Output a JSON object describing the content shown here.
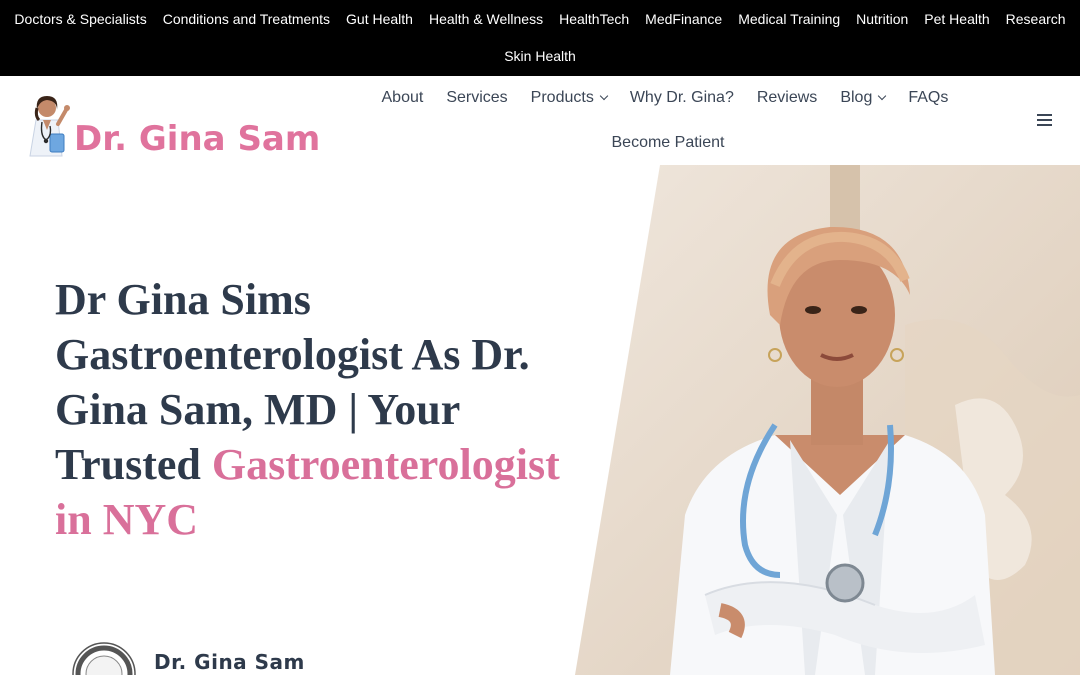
{
  "topbar": {
    "row1": [
      "Doctors & Specialists",
      "Conditions and Treatments",
      "Gut Health",
      "Health & Wellness",
      "HealthTech",
      "MedFinance",
      "Medical Training",
      "Nutrition",
      "Pet Health",
      "Research"
    ],
    "row2": [
      "Skin Health"
    ]
  },
  "header": {
    "logo_text": "Dr. Gina Sam",
    "nav_row1": [
      {
        "label": "About",
        "icon": ""
      },
      {
        "label": "Services",
        "icon": ""
      },
      {
        "label": "Products",
        "icon": "chevron-down-icon"
      },
      {
        "label": "Why Dr. Gina?",
        "icon": ""
      },
      {
        "label": "Reviews",
        "icon": ""
      },
      {
        "label": "Blog",
        "icon": "chevron-down-icon"
      },
      {
        "label": "FAQs",
        "icon": ""
      }
    ],
    "nav_row2": [
      {
        "label": "Become Patient",
        "icon": ""
      }
    ],
    "menu_icon": "hamburger-icon"
  },
  "hero": {
    "title_part1": "Dr Gina Sims Gastroenterologist As Dr. Gina Sam, MD | Your Trusted",
    "title_part2": "Gastroenterologist in NYC",
    "author_name": "Dr. Gina Sam"
  },
  "colors": {
    "topbar_bg": "#000000",
    "brand_pink": "#e0739d",
    "heading_dark": "#2e3a4b",
    "nav_text": "#3b4656"
  }
}
